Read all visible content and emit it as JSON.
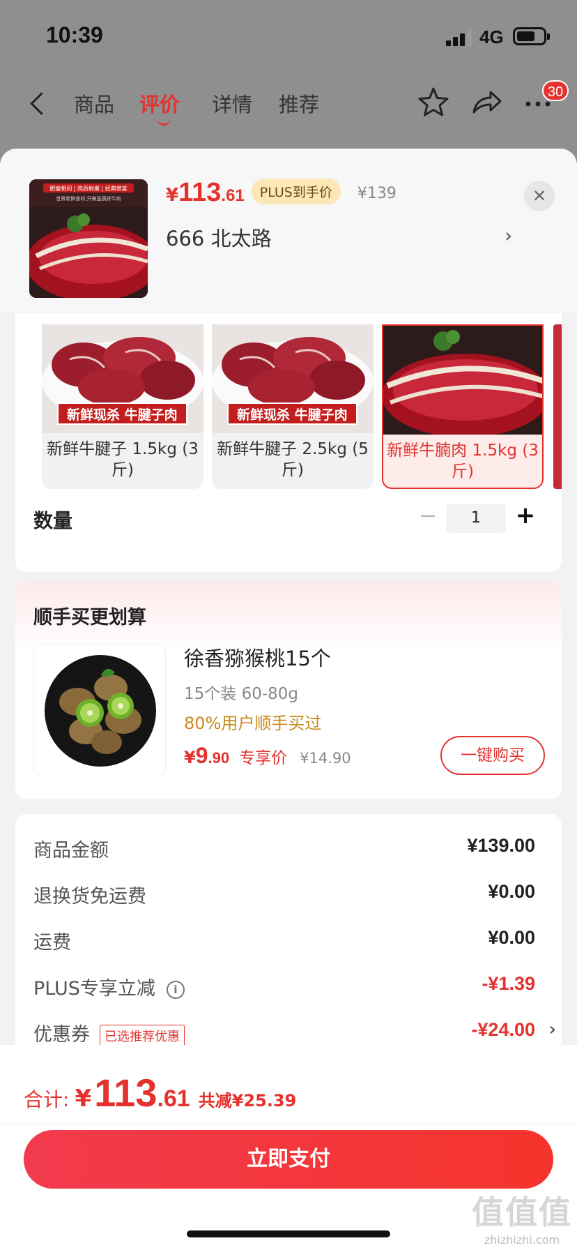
{
  "status_bar": {
    "time": "10:39",
    "network": "4G"
  },
  "nav": {
    "tabs": [
      {
        "label": "商品"
      },
      {
        "label": "评价"
      },
      {
        "label": "详情"
      },
      {
        "label": "推荐"
      }
    ],
    "active_tab": "评价",
    "badge_count": "30"
  },
  "product": {
    "price_symbol": "¥",
    "price_int": "113",
    "price_dec": ".61",
    "plus_tag": "PLUS到手价",
    "original_price": "¥139",
    "address": "666  北太路",
    "thumb_banner": "肥瘦相间 | 肉质鲜嫩 | 经典营宴",
    "thumb_sub": "世界新鲜食材,只做品质好牛肉"
  },
  "specs": [
    {
      "label": "新鲜牛腱子 1.5kg (3斤)",
      "banner": "新鲜现杀 牛腱子肉",
      "selected": false
    },
    {
      "label": "新鲜牛腱子 2.5kg (5斤)",
      "banner": "新鲜现杀 牛腱子肉",
      "selected": false
    },
    {
      "label": "新鲜牛腩肉 1.5kg (3斤)",
      "banner": "",
      "selected": true
    }
  ],
  "quantity": {
    "label": "数量",
    "value": "1",
    "minus": "−",
    "plus": "+"
  },
  "upsell": {
    "title": "顺手买更划算",
    "name": "徐香猕猴桃15个",
    "spec": "15个装  60-80g",
    "social": "80%用户顺手买过",
    "price_symbol": "¥",
    "price_int": "9",
    "price_dec": ".90",
    "price_tag": "专享价",
    "original_price": "¥14.90",
    "buy_label": "一键购买"
  },
  "fees": [
    {
      "label": "商品金额",
      "value": "¥139.00",
      "red": false
    },
    {
      "label": "退换货免运费",
      "value": "¥0.00",
      "red": false
    },
    {
      "label": "运费",
      "value": "¥0.00",
      "red": false
    },
    {
      "label": "PLUS专享立减",
      "value": "-¥1.39",
      "red": true
    },
    {
      "label": "优惠券",
      "value": "-¥24.00",
      "red": true,
      "tag": "已选推荐优惠"
    }
  ],
  "footer": {
    "total_label": "合计:",
    "total_symbol": "¥",
    "total_int": "113",
    "total_dec": ".61",
    "saved": "共减¥25.39",
    "pay_label": "立即支付"
  },
  "watermark": {
    "logo": "值值值",
    "url": "zhizhizhi.com"
  },
  "colors": {
    "accent": "#e4322e",
    "plus_tag_bg": "#fbe7b8",
    "social_text": "#c98a1a"
  }
}
